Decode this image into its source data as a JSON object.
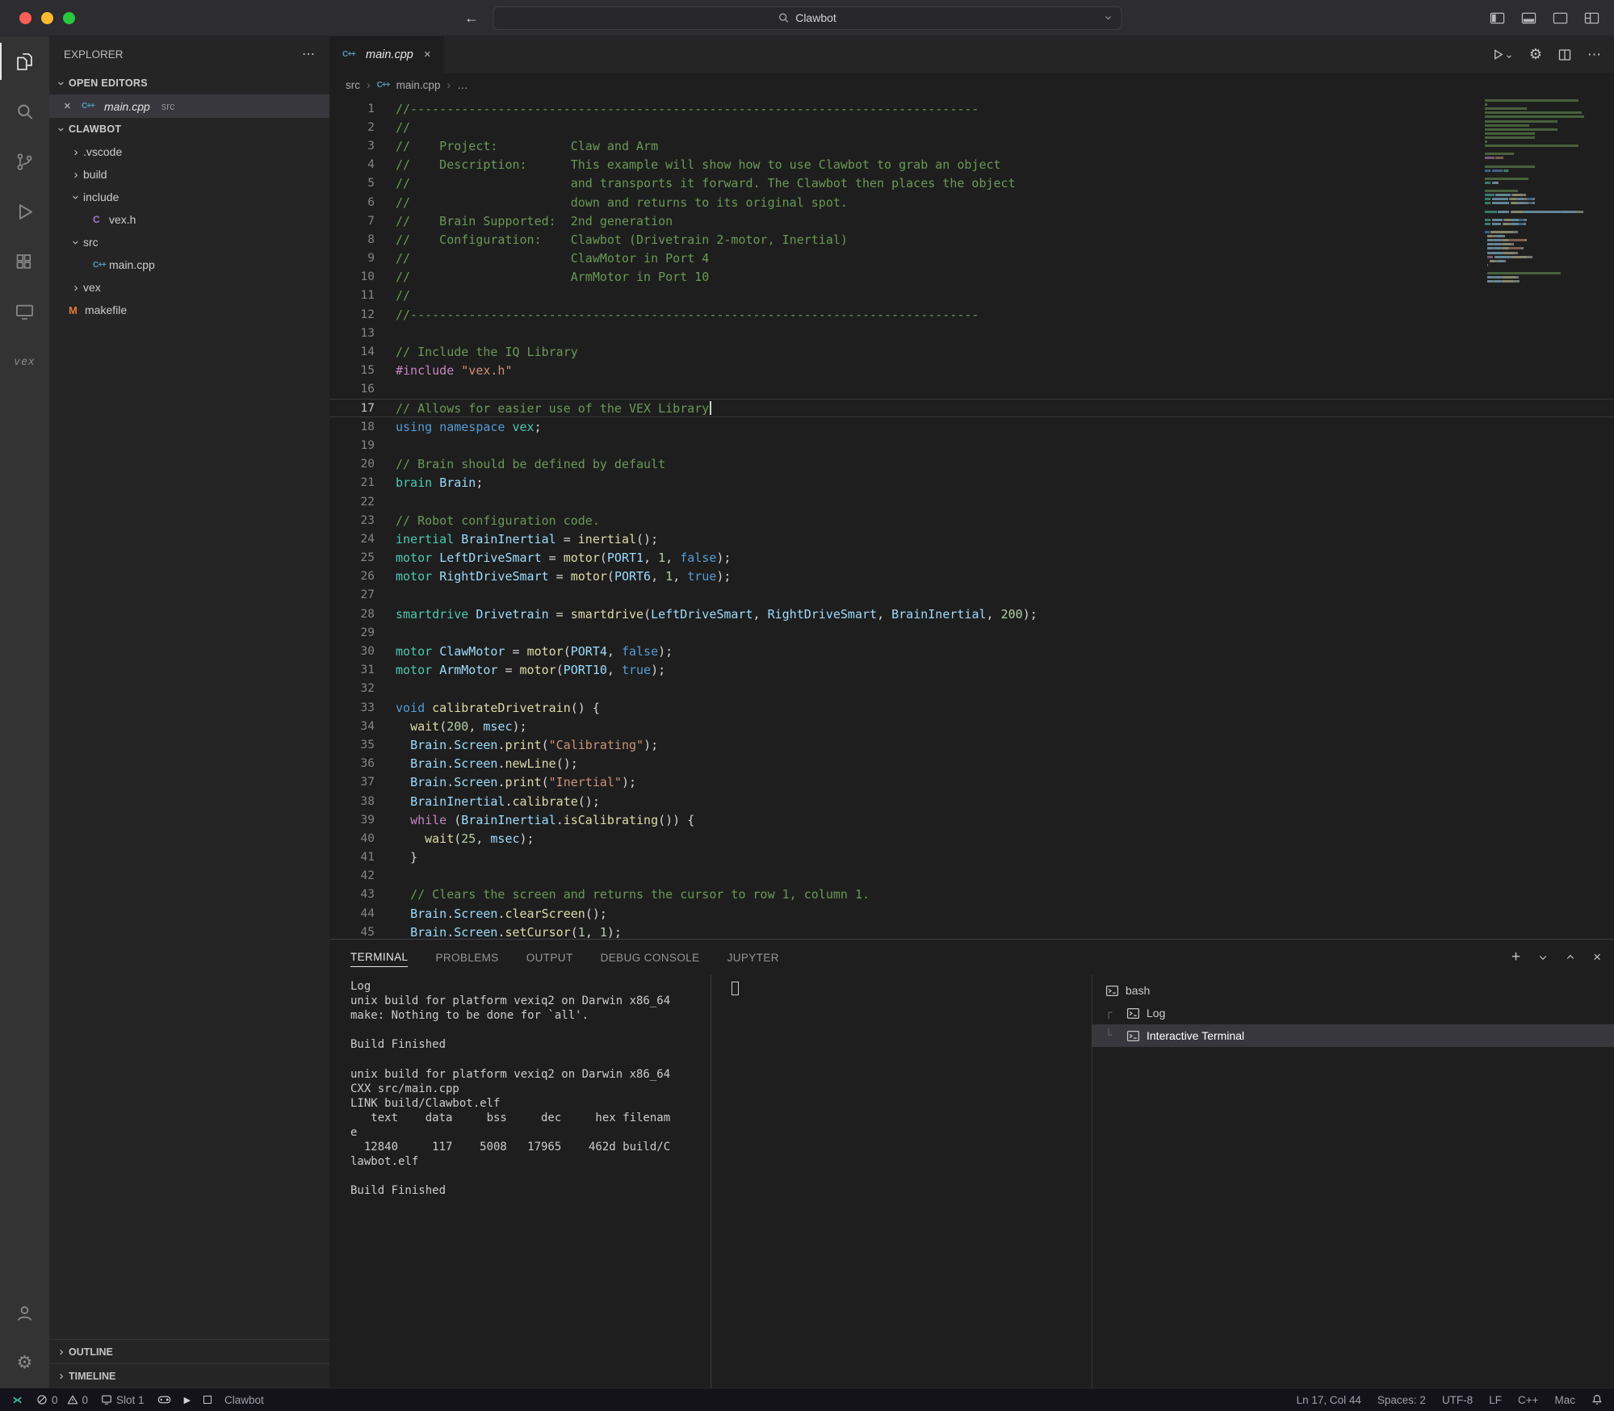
{
  "colors": {
    "comment": "#6A9955",
    "keyword": "#569CD6",
    "control": "#C586C0",
    "type": "#4EC9B0",
    "function": "#DCDCAA",
    "variable": "#9CDCFE",
    "string": "#CE9178",
    "number": "#B5CEA8",
    "selection_bg": "#37373D",
    "cpp_icon": "#519ABA",
    "makefile_icon": "#E37933"
  },
  "icons": {
    "cpp": "C++",
    "c": "C",
    "m": "M",
    "ellipsis": "⋯",
    "close": "×",
    "plus": "+"
  },
  "title_bar": {
    "search_value": "Clawbot"
  },
  "explorer": {
    "title": "EXPLORER",
    "open_editors_label": "OPEN EDITORS",
    "open_editor": {
      "label": "main.cpp",
      "detail": "src"
    },
    "project_label": "CLAWBOT",
    "tree": [
      {
        "level": 1,
        "chevron": "right",
        "label": ".vscode"
      },
      {
        "level": 1,
        "chevron": "right",
        "label": "build"
      },
      {
        "level": 1,
        "chevron": "down",
        "label": "include"
      },
      {
        "level": 2,
        "icon": "c",
        "label": "vex.h"
      },
      {
        "level": 1,
        "chevron": "down",
        "label": "src"
      },
      {
        "level": 2,
        "icon": "cpp",
        "label": "main.cpp"
      },
      {
        "level": 1,
        "chevron": "right",
        "label": "vex"
      },
      {
        "level": 1,
        "icon": "m",
        "label": "makefile"
      }
    ],
    "outline_label": "OUTLINE",
    "timeline_label": "TIMELINE"
  },
  "editor": {
    "tab_label": "main.cpp",
    "breadcrumbs": [
      "src",
      "main.cpp",
      "…"
    ],
    "current_line": 17,
    "code_lines": [
      [
        [
          "cm",
          "//------------------------------------------------------------------------------"
        ]
      ],
      [
        [
          "cm",
          "//"
        ]
      ],
      [
        [
          "cm",
          "//    Project:          Claw and Arm"
        ]
      ],
      [
        [
          "cm",
          "//    Description:      This example will show how to use Clawbot to grab an object"
        ]
      ],
      [
        [
          "cm",
          "//                      and transports it forward. The Clawbot then places the object"
        ]
      ],
      [
        [
          "cm",
          "//                      down and returns to its original spot."
        ]
      ],
      [
        [
          "cm",
          "//    Brain Supported:  2nd generation"
        ]
      ],
      [
        [
          "cm",
          "//    Configuration:    Clawbot (Drivetrain 2-motor, Inertial)"
        ]
      ],
      [
        [
          "cm",
          "//                      ClawMotor in Port 4"
        ]
      ],
      [
        [
          "cm",
          "//                      ArmMotor in Port 10"
        ]
      ],
      [
        [
          "cm",
          "//"
        ]
      ],
      [
        [
          "cm",
          "//------------------------------------------------------------------------------"
        ]
      ],
      [],
      [
        [
          "cm",
          "// Include the IQ Library"
        ]
      ],
      [
        [
          "ctrl",
          "#include"
        ],
        [
          "pl",
          " "
        ],
        [
          "str",
          "\"vex.h\""
        ]
      ],
      [],
      [
        [
          "cm",
          "// Allows for easier use of the VEX Library"
        ]
      ],
      [
        [
          "kw",
          "using"
        ],
        [
          "pl",
          " "
        ],
        [
          "kw",
          "namespace"
        ],
        [
          "pl",
          " "
        ],
        [
          "ty",
          "vex"
        ],
        [
          "pl",
          ";"
        ]
      ],
      [],
      [
        [
          "cm",
          "// Brain should be defined by default"
        ]
      ],
      [
        [
          "ty",
          "brain"
        ],
        [
          "pl",
          " "
        ],
        [
          "vr",
          "Brain"
        ],
        [
          "pl",
          ";"
        ]
      ],
      [],
      [
        [
          "cm",
          "// Robot configuration code."
        ]
      ],
      [
        [
          "ty",
          "inertial"
        ],
        [
          "pl",
          " "
        ],
        [
          "vr",
          "BrainInertial"
        ],
        [
          "pl",
          " = "
        ],
        [
          "fn",
          "inertial"
        ],
        [
          "pl",
          "();"
        ]
      ],
      [
        [
          "ty",
          "motor"
        ],
        [
          "pl",
          " "
        ],
        [
          "vr",
          "LeftDriveSmart"
        ],
        [
          "pl",
          " = "
        ],
        [
          "fn",
          "motor"
        ],
        [
          "pl",
          "("
        ],
        [
          "vr",
          "PORT1"
        ],
        [
          "pl",
          ", "
        ],
        [
          "num",
          "1"
        ],
        [
          "pl",
          ", "
        ],
        [
          "kw",
          "false"
        ],
        [
          "pl",
          ");"
        ]
      ],
      [
        [
          "ty",
          "motor"
        ],
        [
          "pl",
          " "
        ],
        [
          "vr",
          "RightDriveSmart"
        ],
        [
          "pl",
          " = "
        ],
        [
          "fn",
          "motor"
        ],
        [
          "pl",
          "("
        ],
        [
          "vr",
          "PORT6"
        ],
        [
          "pl",
          ", "
        ],
        [
          "num",
          "1"
        ],
        [
          "pl",
          ", "
        ],
        [
          "kw",
          "true"
        ],
        [
          "pl",
          ");"
        ]
      ],
      [],
      [
        [
          "ty",
          "smartdrive"
        ],
        [
          "pl",
          " "
        ],
        [
          "vr",
          "Drivetrain"
        ],
        [
          "pl",
          " = "
        ],
        [
          "fn",
          "smartdrive"
        ],
        [
          "pl",
          "("
        ],
        [
          "vr",
          "LeftDriveSmart"
        ],
        [
          "pl",
          ", "
        ],
        [
          "vr",
          "RightDriveSmart"
        ],
        [
          "pl",
          ", "
        ],
        [
          "vr",
          "BrainInertial"
        ],
        [
          "pl",
          ", "
        ],
        [
          "num",
          "200"
        ],
        [
          "pl",
          ");"
        ]
      ],
      [],
      [
        [
          "ty",
          "motor"
        ],
        [
          "pl",
          " "
        ],
        [
          "vr",
          "ClawMotor"
        ],
        [
          "pl",
          " = "
        ],
        [
          "fn",
          "motor"
        ],
        [
          "pl",
          "("
        ],
        [
          "vr",
          "PORT4"
        ],
        [
          "pl",
          ", "
        ],
        [
          "kw",
          "false"
        ],
        [
          "pl",
          ");"
        ]
      ],
      [
        [
          "ty",
          "motor"
        ],
        [
          "pl",
          " "
        ],
        [
          "vr",
          "ArmMotor"
        ],
        [
          "pl",
          " = "
        ],
        [
          "fn",
          "motor"
        ],
        [
          "pl",
          "("
        ],
        [
          "vr",
          "PORT10"
        ],
        [
          "pl",
          ", "
        ],
        [
          "kw",
          "true"
        ],
        [
          "pl",
          ");"
        ]
      ],
      [],
      [
        [
          "kw",
          "void"
        ],
        [
          "pl",
          " "
        ],
        [
          "fn",
          "calibrateDrivetrain"
        ],
        [
          "pl",
          "() {"
        ]
      ],
      [
        [
          "pl",
          "  "
        ],
        [
          "fn",
          "wait"
        ],
        [
          "pl",
          "("
        ],
        [
          "num",
          "200"
        ],
        [
          "pl",
          ", "
        ],
        [
          "vr",
          "msec"
        ],
        [
          "pl",
          ");"
        ]
      ],
      [
        [
          "pl",
          "  "
        ],
        [
          "vr",
          "Brain"
        ],
        [
          "pl",
          "."
        ],
        [
          "vr",
          "Screen"
        ],
        [
          "pl",
          "."
        ],
        [
          "fn",
          "print"
        ],
        [
          "pl",
          "("
        ],
        [
          "str",
          "\"Calibrating\""
        ],
        [
          "pl",
          ");"
        ]
      ],
      [
        [
          "pl",
          "  "
        ],
        [
          "vr",
          "Brain"
        ],
        [
          "pl",
          "."
        ],
        [
          "vr",
          "Screen"
        ],
        [
          "pl",
          "."
        ],
        [
          "fn",
          "newLine"
        ],
        [
          "pl",
          "();"
        ]
      ],
      [
        [
          "pl",
          "  "
        ],
        [
          "vr",
          "Brain"
        ],
        [
          "pl",
          "."
        ],
        [
          "vr",
          "Screen"
        ],
        [
          "pl",
          "."
        ],
        [
          "fn",
          "print"
        ],
        [
          "pl",
          "("
        ],
        [
          "str",
          "\"Inertial\""
        ],
        [
          "pl",
          ");"
        ]
      ],
      [
        [
          "pl",
          "  "
        ],
        [
          "vr",
          "BrainInertial"
        ],
        [
          "pl",
          "."
        ],
        [
          "fn",
          "calibrate"
        ],
        [
          "pl",
          "();"
        ]
      ],
      [
        [
          "pl",
          "  "
        ],
        [
          "ctrl",
          "while"
        ],
        [
          "pl",
          " ("
        ],
        [
          "vr",
          "BrainInertial"
        ],
        [
          "pl",
          "."
        ],
        [
          "fn",
          "isCalibrating"
        ],
        [
          "pl",
          "()) {"
        ]
      ],
      [
        [
          "pl",
          "    "
        ],
        [
          "fn",
          "wait"
        ],
        [
          "pl",
          "("
        ],
        [
          "num",
          "25"
        ],
        [
          "pl",
          ", "
        ],
        [
          "vr",
          "msec"
        ],
        [
          "pl",
          ");"
        ]
      ],
      [
        [
          "pl",
          "  }"
        ]
      ],
      [],
      [
        [
          "pl",
          "  "
        ],
        [
          "cm",
          "// Clears the screen and returns the cursor to row 1, column 1."
        ]
      ],
      [
        [
          "pl",
          "  "
        ],
        [
          "vr",
          "Brain"
        ],
        [
          "pl",
          "."
        ],
        [
          "vr",
          "Screen"
        ],
        [
          "pl",
          "."
        ],
        [
          "fn",
          "clearScreen"
        ],
        [
          "pl",
          "();"
        ]
      ],
      [
        [
          "pl",
          "  "
        ],
        [
          "vr",
          "Brain"
        ],
        [
          "pl",
          "."
        ],
        [
          "vr",
          "Screen"
        ],
        [
          "pl",
          "."
        ],
        [
          "fn",
          "setCursor"
        ],
        [
          "pl",
          "("
        ],
        [
          "num",
          "1"
        ],
        [
          "pl",
          ", "
        ],
        [
          "num",
          "1"
        ],
        [
          "pl",
          ");"
        ]
      ]
    ]
  },
  "panel": {
    "tabs": [
      "TERMINAL",
      "PROBLEMS",
      "OUTPUT",
      "DEBUG CONSOLE",
      "JUPYTER"
    ],
    "terminal_lines": [
      "Log",
      "unix build for platform vexiq2 on Darwin x86_64",
      "make: Nothing to be done for `all'.",
      "",
      "Build Finished",
      "",
      "unix build for platform vexiq2 on Darwin x86_64",
      "CXX src/main.cpp",
      "LINK build/Clawbot.elf",
      "   text    data     bss     dec     hex filenam",
      "e",
      "  12840     117    5008   17965    462d build/C",
      "lawbot.elf",
      "",
      "Build Finished"
    ],
    "terminals": [
      {
        "label": "bash",
        "guide": "",
        "selected": false
      },
      {
        "label": "Log",
        "guide": "┌",
        "selected": false
      },
      {
        "label": "Interactive Terminal",
        "guide": "└",
        "selected": true
      }
    ]
  },
  "status_bar": {
    "errors": "0",
    "warnings": "0",
    "slot": "Slot 1",
    "project": "Clawbot",
    "line_col": "Ln 17, Col 44",
    "spaces": "Spaces: 2",
    "encoding": "UTF-8",
    "eol": "LF",
    "language": "C++",
    "os": "Mac"
  }
}
